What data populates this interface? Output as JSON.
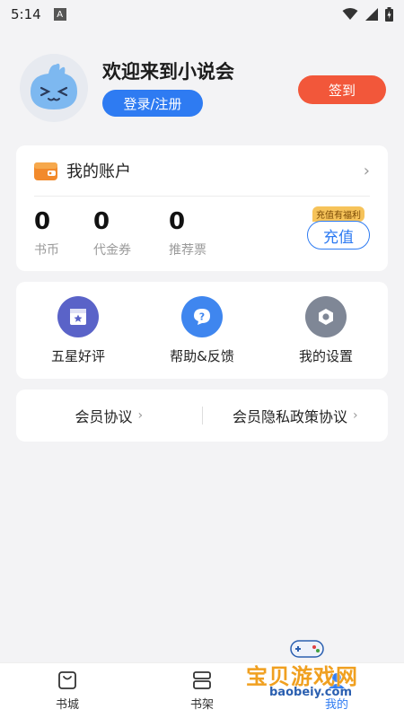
{
  "status_bar": {
    "time": "5:14",
    "notif_letter": "A"
  },
  "header": {
    "welcome": "欢迎来到小说会",
    "login_label": "登录/注册",
    "signin_label": "签到"
  },
  "account": {
    "title": "我的账户",
    "stats": [
      {
        "value": "0",
        "label": "书币"
      },
      {
        "value": "0",
        "label": "代金券"
      },
      {
        "value": "0",
        "label": "推荐票"
      }
    ],
    "badge": "充值有福利",
    "recharge_label": "充值"
  },
  "menu": [
    {
      "label": "五星好评",
      "icon": "star-ticket-icon",
      "color": "#5a63c8"
    },
    {
      "label": "帮助&反馈",
      "icon": "help-question-icon",
      "color": "#3f86ef"
    },
    {
      "label": "我的设置",
      "icon": "settings-hex-icon",
      "color": "#7f8796"
    }
  ],
  "agreements": [
    {
      "label": "会员协议"
    },
    {
      "label": "会员隐私政策协议"
    }
  ],
  "bottom_nav": [
    {
      "label": "书城",
      "icon": "bookstore-bag-icon"
    },
    {
      "label": "书架",
      "icon": "bookshelf-icon"
    },
    {
      "label": "我的",
      "icon": "profile-icon",
      "active": true
    }
  ],
  "watermark": {
    "text": "宝贝游戏网",
    "url": "baobeiy.com"
  },
  "colors": {
    "primary": "#2e7bf2",
    "accent": "#f2573a",
    "background": "#f3f3f5"
  }
}
